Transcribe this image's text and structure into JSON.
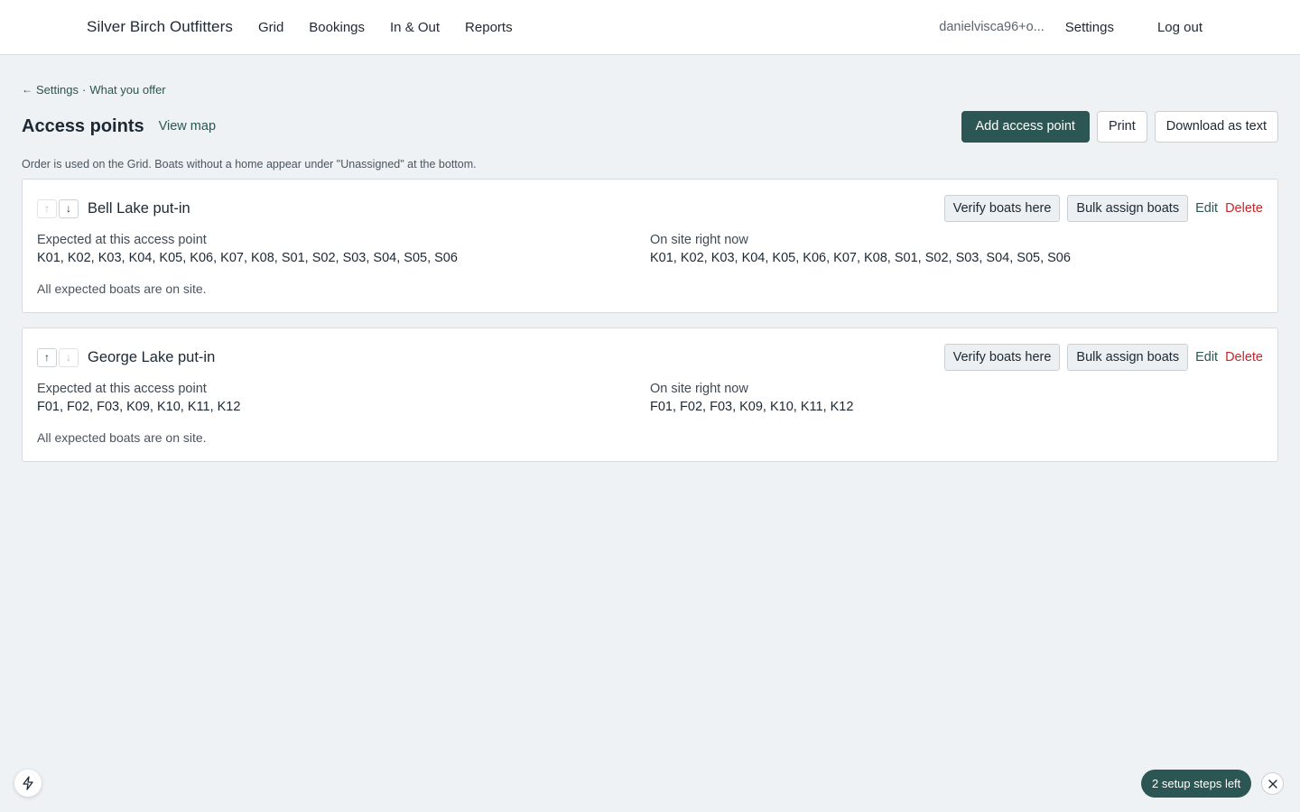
{
  "header": {
    "brand": "Silver Birch Outfitters",
    "nav": [
      "Grid",
      "Bookings",
      "In & Out",
      "Reports"
    ],
    "user": "danielvisca96+o...",
    "settings_label": "Settings",
    "logout_label": "Log out"
  },
  "breadcrumb": {
    "arrow": "←",
    "parent": "Settings",
    "separator": "·",
    "current": "What you offer"
  },
  "page": {
    "title": "Access points",
    "view_map_label": "View map",
    "add_label": "Add access point",
    "print_label": "Print",
    "download_label": "Download as text",
    "hint": "Order is used on the Grid. Boats without a home appear under \"Unassigned\" at the bottom."
  },
  "access_points": [
    {
      "name": "Bell Lake put-in",
      "expected_label": "Expected at this access point",
      "expected": "K01, K02, K03, K04, K05, K06, K07, K08, S01, S02, S03, S04, S05, S06",
      "onsite_label": "On site right now",
      "onsite": "K01, K02, K03, K04, K05, K06, K07, K08, S01, S02, S03, S04, S05, S06",
      "status": "All expected boats are on site.",
      "verify_label": "Verify boats here",
      "bulk_label": "Bulk assign boats",
      "edit_label": "Edit",
      "delete_label": "Delete",
      "move_up_enabled": false,
      "move_down_enabled": true
    },
    {
      "name": "George Lake put-in",
      "expected_label": "Expected at this access point",
      "expected": "F01, F02, F03, K09, K10, K11, K12",
      "onsite_label": "On site right now",
      "onsite": "F01, F02, F03, K09, K10, K11, K12",
      "status": "All expected boats are on site.",
      "verify_label": "Verify boats here",
      "bulk_label": "Bulk assign boats",
      "edit_label": "Edit",
      "delete_label": "Delete",
      "move_up_enabled": true,
      "move_down_enabled": false
    }
  ],
  "footer": {
    "setup_label": "2 setup steps left"
  },
  "icons": {
    "up": "↑",
    "down": "↓",
    "bolt": "bolt-icon",
    "close": "close-icon"
  },
  "colors": {
    "primary": "#2c5653",
    "danger": "#c8282d",
    "background": "#eef2f5"
  }
}
